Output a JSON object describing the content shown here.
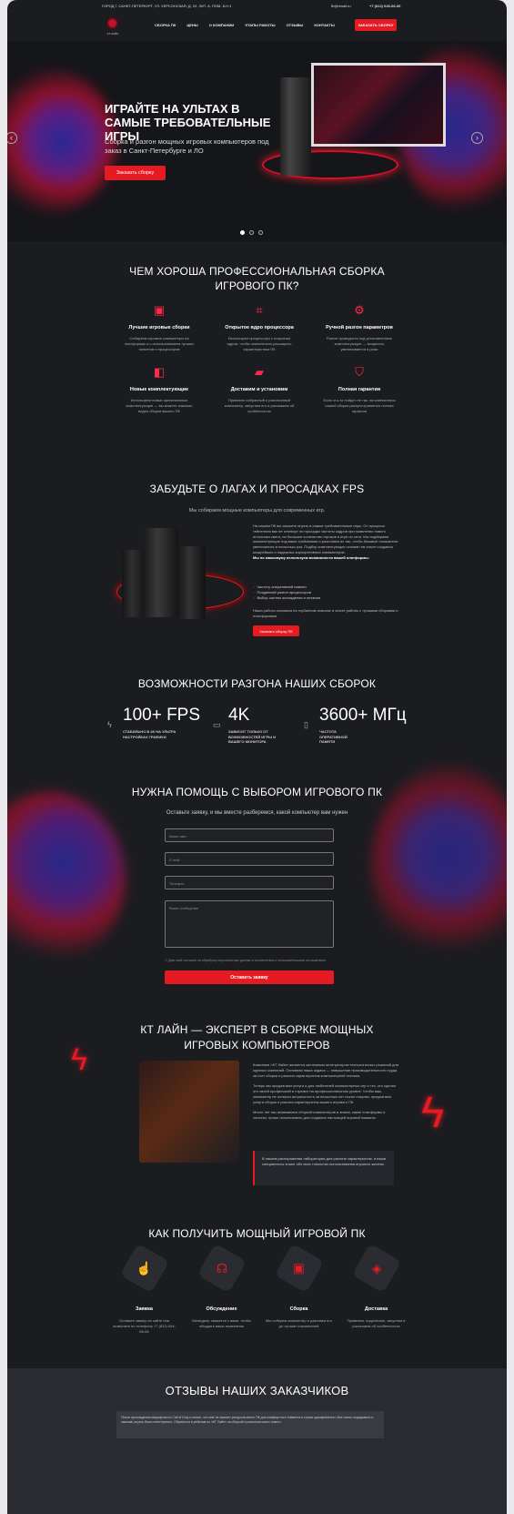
{
  "topbar": {
    "address": "ГОРОД Г. САНКТ-ПЕТЕРБУРГ, УЛ. ХЕРСОНСКАЯ, Д. 20, ЛИТ. А, ПОМ. 8-Н 4",
    "email": "fb@dmail.ru",
    "phone": "+7 (812) 646-66-06"
  },
  "nav": {
    "logo_text": "КТ ЛАЙН",
    "items": [
      "СБОРКА ПК",
      "ЦЕНЫ",
      "О КОМПАНИИ",
      "ЭТАПЫ РАБОТЫ",
      "ОТЗЫВЫ",
      "КОНТАКТЫ"
    ],
    "cta": "ЗАКАЗАТЬ СБОРКУ"
  },
  "hero": {
    "title": "ИГРАЙТЕ НА УЛЬТАХ В САМЫЕ ТРЕБОВАТЕЛЬНЫЕ ИГРЫ",
    "subtitle": "Сборка и разгон мощных игровых компьютеров под заказ в Санкт-Петербурге и ЛО",
    "button": "Заказать сборку",
    "prev": "‹",
    "next": "›",
    "active_slide": 1,
    "slides": 3
  },
  "why": {
    "title_line1": "ЧЕМ ХОРОША ПРОФЕССИОНАЛЬНАЯ СБОРКА",
    "title_line2": "ИГРОВОГО ПК?",
    "items": [
      {
        "icon": "cpu-icon",
        "title": "Лучшие игровые сборки",
        "text": "Собираем игровые компьютеры на платформах и с использованием лучших чипсетов и процессоров"
      },
      {
        "icon": "chip-icon",
        "title": "Открытое ядро процессора",
        "text": "Используем процессоры с открытым ядром, чтобы значительно расширить характеристики ПК"
      },
      {
        "icon": "settings-icon",
        "title": "Ручной разгон параметров",
        "text": "Разгон проводится под установленные комплектующие — мощность увеличивается в разы"
      },
      {
        "icon": "component-icon",
        "title": "Новые комплектующие",
        "text": "Используем новые оригинальные комплектующие — вы можете заказать видео сборки вашего ПК"
      },
      {
        "icon": "truck-icon",
        "title": "Доставим и установим",
        "text": "Привезем собранный и разогнанный компьютер, запустим его и расскажем об особенностях"
      },
      {
        "icon": "shield-icon",
        "title": "Полная гарантия",
        "text": "Если что-то пойдет не так, на компьютеры нашей сборки распространяется полная гарантия"
      }
    ]
  },
  "fps": {
    "title": "ЗАБУДЬТЕ О ЛАГАХ И ПРОСАДКАХ FPS",
    "subtitle": "Мы собираем мощные компьютеры для современных игр.",
    "text1": "На нашем ПК вы сможете играть в самые требовательные игры. От процесса тейнеллия вас не отвлекут ни просадки частоты кадров при появлении нового источника света, ни большое количество игроков в игре по сети. Мы подбираем комплектующие под ваши требования и разгоняем их так, чтобы базовые показатели увеличились в несколько раз. Подбор комплектующих основан на опыте создания мощнейших и надежных корпоративных компьютеров.",
    "bold": "Мы по максимуму используем возможности вашей платформы:",
    "list": [
      "Частоту оперативной памяти",
      "Поэдинный разгон процессоров",
      "Выбор систем охлаждения и питания"
    ],
    "text2": "Наша работа основана на глубинном анализе и опыте работы с лучшими сборками и платформами.",
    "button": "Заказать сборку ПК"
  },
  "overclock": {
    "title": "ВОЗМОЖНОСТИ РАЗГОНА НАШИХ СБОРОК",
    "stats": [
      {
        "icon": "lightning-icon",
        "value": "100+ FPS",
        "label": "СТАБИЛЬНО В 4К НА УЛЬТРА НАСТРОЙКАХ ГРАФИКИ"
      },
      {
        "icon": "monitor-icon",
        "value": "4K",
        "label": "ЗАВИСИТ ТОЛЬКО ОТ ВОЗМОЖНОСТЕЙ ИГРЫ И ВАШЕГО МОНИТОРА"
      },
      {
        "icon": "memory-icon",
        "value": "3600+ МГц",
        "label": "ЧАСТОТА ОПЕРАТИВНОЙ ПАМЯТИ"
      }
    ]
  },
  "help": {
    "title": "НУЖНА ПОМОЩЬ С ВЫБОРОМ ИГРОВОГО ПК",
    "subtitle": "Оставьте заявку, и мы вместе разберемся, какой компьютер вам нужен",
    "name_ph": "Ваше имя",
    "email_ph": "E-mail",
    "phone_ph": "Телефон",
    "message_ph": "Ваше сообщение",
    "consent": "Даю своё согласие на обработку персональных данных в соответствии с пользовательским соглашением",
    "submit": "Оставить заявку"
  },
  "about": {
    "title_line1": "КТ ЛАЙН — ЭКСПЕРТ В СБОРКЕ МОЩНЫХ",
    "title_line2": "ИГРОВЫХ КОМПЬЮТЕРОВ",
    "p1": "Компания «КТ Лайн» является системным интегратором технологичных решений для крупных компаний. Основная наша задача — повышение производительности труда за счет сборки и разгона характеристик компьютерной техники.",
    "p2": "Теперь мы предлагаем услуги и для любителей компьютерных игр и тех, кто сделал это своей профессией и стремит на профессиональном уровне. Чтобы ваш компьютер не потерял актуальность за несколько лет после покупки, предлагаем услуги сборки и разгона характеристик вашего игрового ПК.",
    "p3": "Много лет мы занимаемся сборкой компьютеров и знаем, какие платформы и чипсеты лучше использовать для создания настоящей игровой машины.",
    "quote": "В нашем распоряжении лаборатория для разгона характеристик, а наши специалисты знают обо всех тонкостях использования игрового железа."
  },
  "how": {
    "title": "КАК ПОЛУЧИТЬ МОЩНЫЙ ИГРОВОЙ ПК",
    "steps": [
      {
        "icon": "touch-icon",
        "title": "Заявка",
        "text": "Оставьте заявку на сайте или позвоните по телефону +7 (812) 644-66-06"
      },
      {
        "icon": "headset-icon",
        "title": "Обсуждение",
        "text": "Менеджер свяжется с вами, чтобы обсудить ваши пожелания"
      },
      {
        "icon": "computer-icon",
        "title": "Сборка",
        "text": "Мы соберем компьютер и разгоним его до лучших показателей"
      },
      {
        "icon": "box-icon",
        "title": "Доставка",
        "text": "Привезем, подключим, запустим и расскажем об особенностях"
      }
    ]
  },
  "reviews": {
    "title": "ОТЗЫВЫ НАШИХ ЗАКАЗЧИКОВ",
    "first": "После прохождения марафона по Call of Duty и понял, что мне не хватает ресурсов моего ПК для комфортного гейминга и стрим одновременно. Все очень порадовало и заказав, играть было неинтересно. Обратился в ребятам из «КТ Лайн» за сборкой и разгоном моего нового."
  },
  "colors": {
    "accent": "#e41b23",
    "background": "#1b1c20"
  }
}
